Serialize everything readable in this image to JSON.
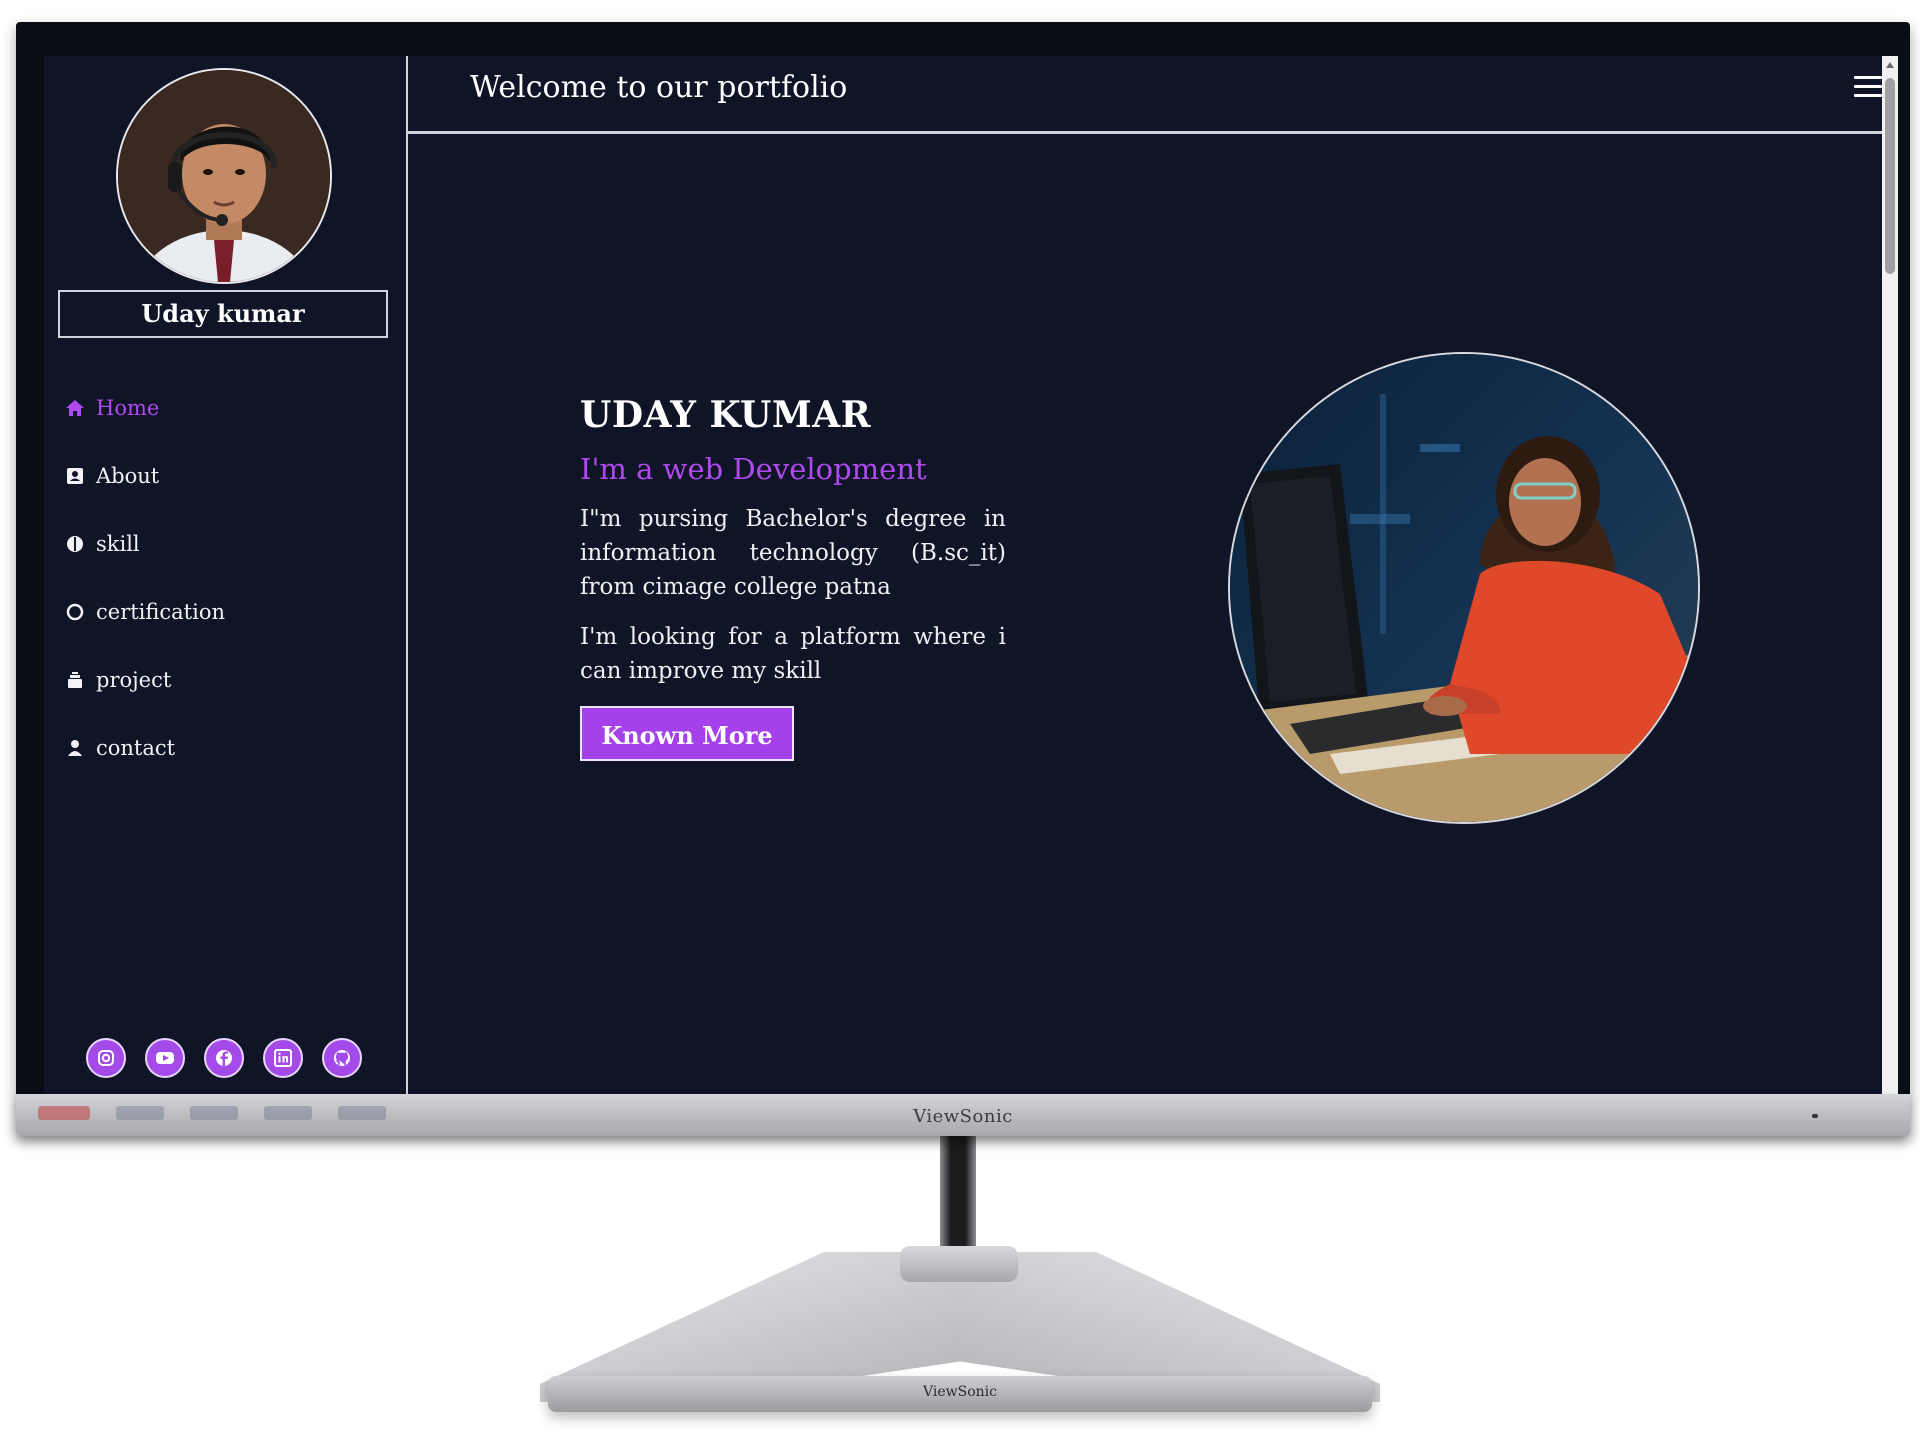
{
  "sidebar": {
    "profile_name": "Uday kumar",
    "nav": [
      {
        "label": "Home",
        "icon": "home-icon",
        "active": true
      },
      {
        "label": "About",
        "icon": "address-card-icon",
        "active": false
      },
      {
        "label": "skill",
        "icon": "brain-icon",
        "active": false
      },
      {
        "label": "certification",
        "icon": "ring-icon",
        "active": false
      },
      {
        "label": "project",
        "icon": "layers-icon",
        "active": false
      },
      {
        "label": "contact",
        "icon": "user-icon",
        "active": false
      }
    ],
    "socials": [
      "instagram-icon",
      "youtube-icon",
      "facebook-icon",
      "linkedin-icon",
      "github-icon"
    ]
  },
  "topbar": {
    "title": "Welcome to our portfolio",
    "menu_icon": "hamburger-menu-icon"
  },
  "hero": {
    "name": "UDAY KUMAR",
    "role": "I'm a web Development",
    "para1": "I\"m pursing Bachelor's degree in information technology (B.sc_it) from cimage college patna",
    "para2": "I'm looking for a platform where i can improve my skill",
    "cta_label": "Known More"
  },
  "monitor": {
    "brand": "ViewSonic",
    "base_brand": "ViewSonic"
  },
  "colors": {
    "accent": "#a541eb",
    "accent_text": "#b04af0",
    "background": "#0f1526",
    "text": "#ffffff"
  }
}
